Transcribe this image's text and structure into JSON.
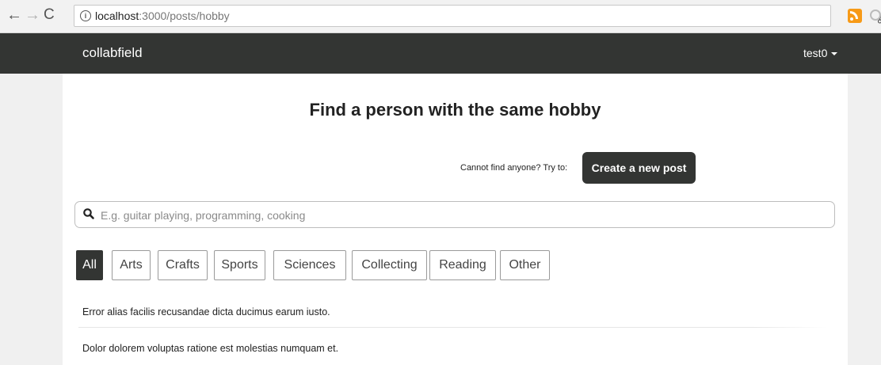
{
  "browser": {
    "url_host": "localhost",
    "url_path": ":3000/posts/hobby"
  },
  "navbar": {
    "brand": "collabfield",
    "user": "test0"
  },
  "page": {
    "title": "Find a person with the same hobby",
    "prompt": "Cannot find anyone? Try to:",
    "create_button": "Create a new post"
  },
  "search": {
    "placeholder": "E.g. guitar playing, programming, cooking"
  },
  "categories": [
    "All",
    "Arts",
    "Crafts",
    "Sports",
    "Sciences",
    "Collecting",
    "Reading",
    "Other"
  ],
  "selected_category": "All",
  "posts": [
    "Error alias facilis recusandae dicta ducimus earum iusto.",
    "Dolor dolorem voluptas ratione est molestias numquam et."
  ],
  "colors": {
    "navbar_bg": "#333533",
    "accent": "#333533",
    "rss": "#f79a17"
  }
}
